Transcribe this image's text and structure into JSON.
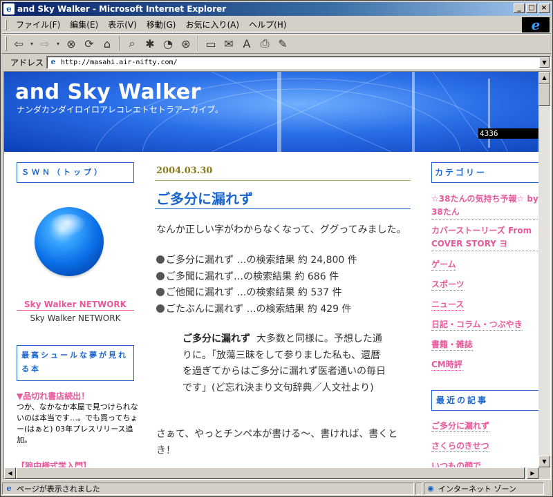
{
  "window": {
    "title": "and Sky Walker - Microsoft Internet Explorer",
    "ie_icon": "e"
  },
  "menu": [
    "ファイル(F)",
    "編集(E)",
    "表示(V)",
    "移動(G)",
    "お気に入り(A)",
    "ヘルプ(H)"
  ],
  "toolbar": {
    "icons": [
      "back-icon",
      "forward-icon",
      "stop-icon",
      "refresh-icon",
      "home-icon",
      "search-icon",
      "favorites-icon",
      "history-icon",
      "channels-icon",
      "fullscreen-icon",
      "mail-icon",
      "font-icon",
      "print-icon",
      "edit-icon"
    ]
  },
  "address": {
    "label": "アドレス",
    "url": "http://masahi.air-nifty.com/"
  },
  "header": {
    "title": "and Sky Walker",
    "subtitle": "ナンダカンダイロイロアレコレエトセトラアーカイブ。",
    "counter": "4336"
  },
  "left": {
    "swn_label": "ＳＷＮ（トップ）",
    "network_link": "Sky Walker NETWORK",
    "network_text": "Sky Walker NETWORK",
    "dream_label": "最高シュールな夢が見れる本",
    "shop_link": "▼品切れ書店続出！",
    "shop_text": "つか、なかなか本屋で見つけられないのは本当です…。でも買ってちょー(はぁと) 03年プレスリリース追加。",
    "cut_link": "【狼中様式学入門】"
  },
  "post": {
    "date": "2004.03.30",
    "title": "ご多分に漏れず",
    "intro": "なんか正しい字がわからなくなって、ググってみました。",
    "results": [
      "ご多分に漏れず …の検索結果 約 24,800 件",
      "ご多聞に漏れず…の検索結果 約 686 件",
      "ご他聞に漏れず …の検索結果 約 537 件",
      "ごたぶんに漏れず …の検索結果 約 429 件"
    ],
    "quote_term": "ご多分に漏れず",
    "quote_body": "大多数と同様に。予想した通りに。「放蕩三昧をして参りました私も、還暦を過ぎてからはご多分に漏れず医者通いの毎日です」(ど忘れ決まり文句辞典／人文社より)",
    "outro": "さぁて、やっとチンペ本が書ける〜、書ければ、書くとき！"
  },
  "right": {
    "category_label": "カテゴリー",
    "categories": [
      "☆38たんの気持ち予報☆ by 38たん",
      "カバーストーリーズ From COVER STORY ヨ",
      "ゲーム",
      "スポーツ",
      "ニュース",
      "日記・コラム・つぶやき",
      "書籍・雑誌",
      "CM時評"
    ],
    "recent_label": "最近の記事",
    "recent": [
      "ご多分に漏れず",
      "さくらのきせつ",
      "いつもの顔で"
    ]
  },
  "status": {
    "text": "ページが表示されました",
    "zone": "インターネット ゾーン"
  }
}
